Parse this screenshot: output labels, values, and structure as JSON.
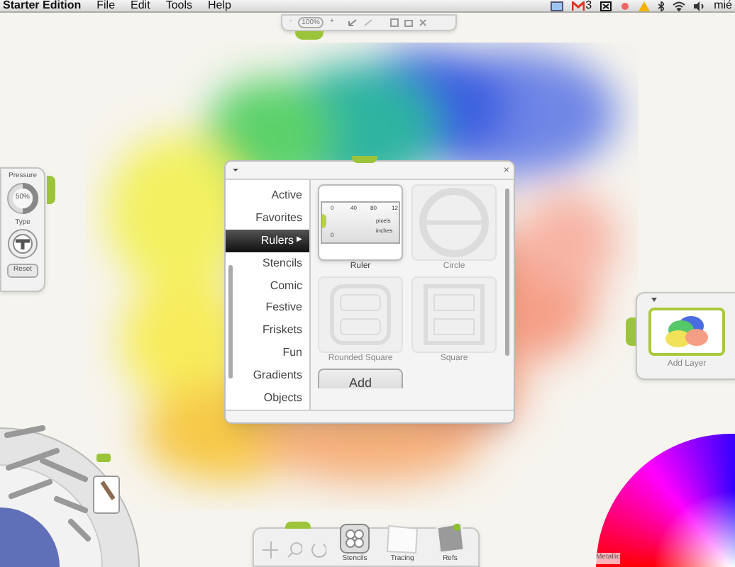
{
  "menu_bar": {
    "app": "Starter Edition",
    "items": [
      "File",
      "Edit",
      "Tools",
      "Help"
    ],
    "mail_count": "3",
    "clock": "mié"
  },
  "top_toolbar": {
    "zoom_out": "-",
    "zoom": "100%",
    "zoom_in": "+"
  },
  "pressure_panel": {
    "pressure_label": "Pressure",
    "pressure": "50%",
    "pressure_dial": {
      "level": 0.5
    },
    "type_label": "Type",
    "reset": "Reset"
  },
  "stencil_panel": {
    "categories": [
      {
        "label": "Active",
        "selected": false
      },
      {
        "label": "Favorites",
        "selected": false
      },
      {
        "label": "Rulers",
        "selected": true
      },
      {
        "label": "Stencils",
        "selected": false
      },
      {
        "label": "Comic",
        "selected": false
      },
      {
        "label": "Festive",
        "selected": false
      },
      {
        "label": "Friskets",
        "selected": false
      },
      {
        "label": "Fun",
        "selected": false
      },
      {
        "label": "Gradients",
        "selected": false
      },
      {
        "label": "Objects",
        "selected": false
      }
    ],
    "selected_arrow": "▶",
    "close": "×",
    "ruler_labels": [
      "0",
      "40",
      "80",
      "12",
      "pixels",
      "inches",
      "0"
    ],
    "items": [
      {
        "kind": "ruler",
        "label": "Ruler",
        "disabled": false
      },
      {
        "kind": "circle",
        "label": "Circle",
        "disabled": true
      },
      {
        "kind": "rounded_square",
        "label": "Rounded Square",
        "disabled": true
      },
      {
        "kind": "square",
        "label": "Square",
        "disabled": true
      }
    ],
    "add": "Add"
  },
  "layer_panel": {
    "add_layer": "Add Layer"
  },
  "bottom_toolbar": {
    "items": [
      {
        "kind": "stencils",
        "label": "Stencils"
      },
      {
        "kind": "tracing",
        "label": "Tracing"
      },
      {
        "kind": "refs",
        "label": "Refs"
      }
    ]
  },
  "color_picker": {
    "metallic_label": "Metallic"
  }
}
